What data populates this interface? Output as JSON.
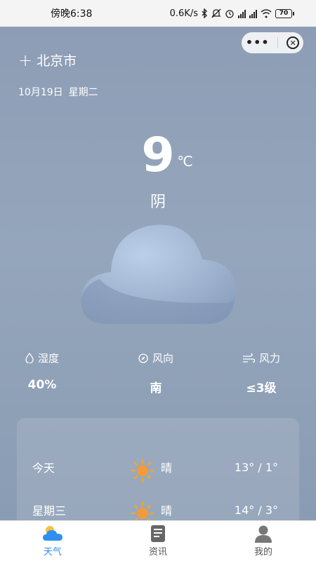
{
  "status_bar": {
    "time": "傍晚6:38",
    "net_speed": "0.6K/s",
    "battery": "70"
  },
  "capsule": {
    "more_icon": "more-dots-icon",
    "close_icon": "close-circle-icon"
  },
  "location": {
    "add_icon": "+",
    "city": "北京市"
  },
  "date": {
    "day": "10月19日",
    "weekday": "星期二"
  },
  "current": {
    "temperature": "9",
    "unit": "℃",
    "condition": "阴"
  },
  "metrics": [
    {
      "label": "湿度",
      "value": "40%",
      "icon": "droplet-icon"
    },
    {
      "label": "风向",
      "value": "南",
      "icon": "compass-icon"
    },
    {
      "label": "风力",
      "value": "≤3级",
      "icon": "wind-icon"
    }
  ],
  "forecast": [
    {
      "day": "今天",
      "condition": "晴",
      "range": "13° / 1°",
      "icon": "sun-icon"
    },
    {
      "day": "星期三",
      "condition": "晴",
      "range": "14° / 3°",
      "icon": "sun-icon"
    }
  ],
  "tabs": [
    {
      "label": "天气",
      "icon": "weather-cloud-icon",
      "active": true
    },
    {
      "label": "资讯",
      "icon": "news-icon",
      "active": false
    },
    {
      "label": "我的",
      "icon": "profile-icon",
      "active": false
    }
  ],
  "colors": {
    "accent": "#2f8ff0",
    "background": "#8c9cb4"
  }
}
